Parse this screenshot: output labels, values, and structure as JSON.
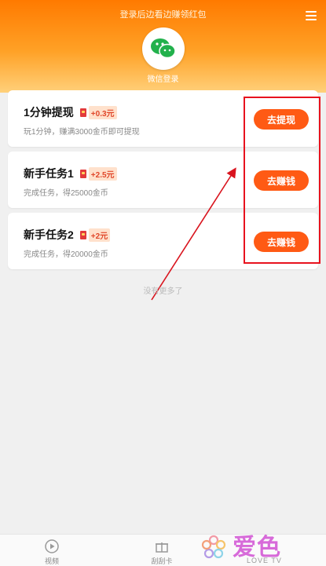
{
  "header": {
    "title": "登录后边看边赚领红包",
    "wechat_login_label": "微信登录"
  },
  "tasks": [
    {
      "title": "1分钟提现",
      "reward": "+0.3元",
      "desc": "玩1分钟，赚满3000金币即可提现",
      "button": "去提现"
    },
    {
      "title": "新手任务1",
      "reward": "+2.5元",
      "desc": "完成任务，得25000金币",
      "button": "去赚钱"
    },
    {
      "title": "新手任务2",
      "reward": "+2元",
      "desc": "完成任务，得20000金币",
      "button": "去赚钱"
    }
  ],
  "no_more_text": "没有更多了",
  "bottom_tabs": [
    {
      "label": "视频",
      "icon": "play-icon"
    },
    {
      "label": "刮刮卡",
      "icon": "gift-icon"
    }
  ],
  "watermark": {
    "text": "爱色",
    "sub": "LOVE TV"
  },
  "colors": {
    "accent": "#ff5a14",
    "header_top": "#ff7a00",
    "highlight": "#e8121e",
    "reward_text": "#e0482b"
  }
}
